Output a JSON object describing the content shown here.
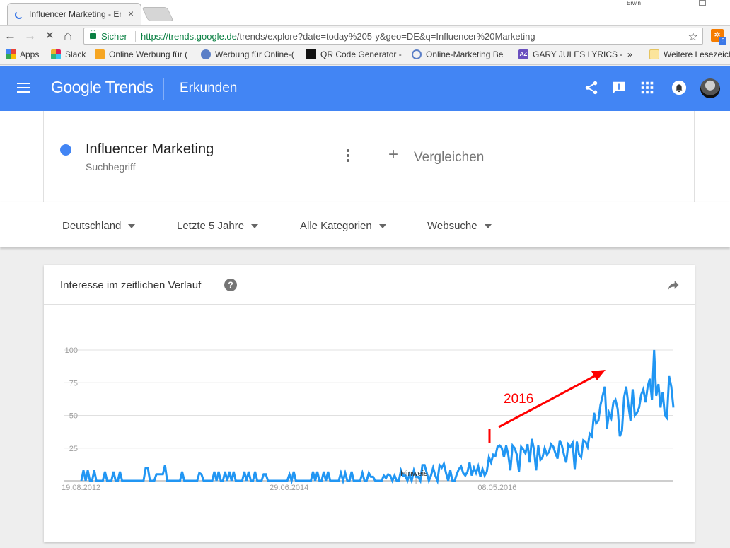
{
  "browser": {
    "tab_title": "Influencer Marketing - Er",
    "tab_close": "×",
    "window_user": "Erwin",
    "nav": {
      "back": "←",
      "forward": "→",
      "stop": "✕",
      "home": "⌂"
    },
    "security_label": "Sicher",
    "url_host": "https://trends.google.de",
    "url_path": "/trends/explore?date=today%205-y&geo=DE&q=Influencer%20Marketing",
    "star": "☆",
    "extension_badge": "6",
    "bookmarks": [
      {
        "label": "Apps",
        "icon": "apps-grid-icon"
      },
      {
        "label": "Slack",
        "icon": "slack-icon"
      },
      {
        "label": "Online Werbung für (",
        "icon": "puzzle-icon"
      },
      {
        "label": "Werbung für Online-(",
        "icon": "globe-icon"
      },
      {
        "label": "QR Code Generator -",
        "icon": "qr-icon"
      },
      {
        "label": "Online-Marketing Be",
        "icon": "swirl-icon"
      },
      {
        "label": "GARY JULES LYRICS -",
        "icon": "az-icon"
      }
    ],
    "bookmarks_overflow": "»",
    "other_bookmarks": "Weitere Lesezeich"
  },
  "appbar": {
    "logo_google": "Google",
    "logo_trends": "Trends",
    "title": "Erkunden",
    "icons": [
      "share-icon",
      "feedback-icon",
      "apps-icon",
      "notifications-icon",
      "avatar"
    ]
  },
  "search_term": {
    "name": "Influencer Marketing",
    "type": "Suchbegriff",
    "color": "#4285f4"
  },
  "compare": {
    "plus": "+",
    "label": "Vergleichen"
  },
  "filters": [
    {
      "label": "Deutschland"
    },
    {
      "label": "Letzte 5 Jahre"
    },
    {
      "label": "Alle Kategorien"
    },
    {
      "label": "Websuche"
    }
  ],
  "card": {
    "title": "Interesse im zeitlichen Verlauf",
    "help": "?"
  },
  "chart_data": {
    "type": "line",
    "title": "Interesse im zeitlichen Verlauf",
    "xlabel": "",
    "ylabel": "",
    "ylim": [
      0,
      100
    ],
    "yticks": [
      25,
      50,
      75,
      100
    ],
    "xtick_labels": [
      "19.08.2012",
      "29.06.2014",
      "08.05.2016"
    ],
    "xtick_positions_index": [
      0,
      97,
      194
    ],
    "grid": true,
    "line_color": "#2196f3",
    "note_label": "Hinweis",
    "note_index": 156,
    "annotation": {
      "text": "2016",
      "color": "#ff0000",
      "type": "arrow + marker"
    },
    "series": [
      {
        "name": "Influencer Marketing",
        "values": [
          0,
          8,
          0,
          8,
          0,
          0,
          8,
          0,
          0,
          0,
          0,
          7,
          0,
          0,
          0,
          7,
          0,
          0,
          7,
          0,
          0,
          0,
          0,
          0,
          0,
          0,
          0,
          0,
          0,
          0,
          10,
          10,
          0,
          0,
          0,
          5,
          5,
          5,
          5,
          12,
          0,
          0,
          0,
          0,
          0,
          0,
          0,
          7,
          0,
          0,
          0,
          0,
          0,
          0,
          0,
          6,
          5,
          0,
          0,
          0,
          0,
          0,
          7,
          0,
          7,
          0,
          0,
          7,
          0,
          7,
          0,
          7,
          0,
          0,
          0,
          0,
          7,
          0,
          7,
          0,
          0,
          7,
          0,
          0,
          0,
          5,
          5,
          0,
          0,
          0,
          0,
          0,
          0,
          0,
          0,
          0,
          0,
          5,
          0,
          7,
          0,
          0,
          0,
          0,
          0,
          0,
          0,
          0,
          7,
          0,
          7,
          0,
          0,
          7,
          0,
          7,
          0,
          0,
          0,
          0,
          0,
          6,
          0,
          6,
          0,
          0,
          7,
          0,
          0,
          0,
          0,
          6,
          0,
          0,
          6,
          3,
          3,
          0,
          0,
          0,
          0,
          4,
          2,
          5,
          4,
          0,
          4,
          0,
          0,
          8,
          4,
          4,
          0,
          5,
          0,
          8,
          3,
          3,
          0,
          12,
          12,
          6,
          0,
          4,
          10,
          4,
          0,
          12,
          10,
          13,
          6,
          0,
          8,
          0,
          0,
          5,
          9,
          11,
          6,
          4,
          7,
          14,
          4,
          10,
          6,
          11,
          3,
          9,
          4,
          7,
          18,
          14,
          20,
          19,
          26,
          27,
          25,
          18,
          27,
          20,
          8,
          27,
          25,
          20,
          7,
          26,
          24,
          21,
          28,
          14,
          32,
          24,
          8,
          27,
          16,
          18,
          25,
          20,
          22,
          28,
          26,
          21,
          17,
          31,
          27,
          20,
          14,
          28,
          26,
          29,
          9,
          30,
          20,
          18,
          31,
          30,
          26,
          36,
          34,
          52,
          44,
          46,
          58,
          65,
          72,
          40,
          52,
          48,
          60,
          62,
          55,
          34,
          38,
          64,
          72,
          58,
          46,
          70,
          50,
          52,
          56,
          66,
          70,
          60,
          72,
          78,
          62,
          100,
          65,
          74,
          56,
          68,
          50,
          48,
          80,
          72,
          56
        ]
      }
    ]
  }
}
